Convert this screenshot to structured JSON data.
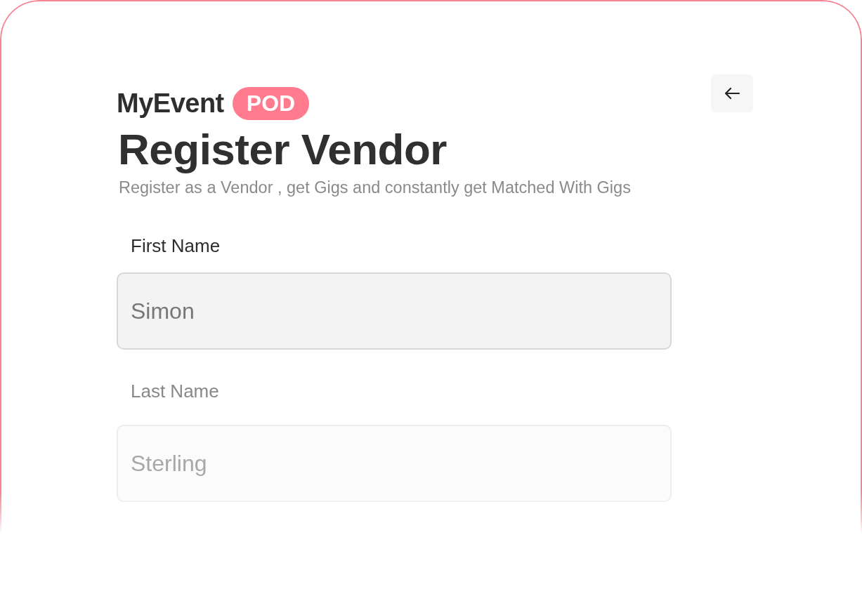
{
  "brand": {
    "name": "MyEvent",
    "badge": "POD"
  },
  "title": "Register Vendor",
  "subtitle": "Register as a Vendor , get Gigs and constantly get Matched With Gigs",
  "fields": [
    {
      "label": "First Name",
      "value": "Simon",
      "faded": false
    },
    {
      "label": "Last Name",
      "value": "Sterling",
      "faded": true
    }
  ]
}
